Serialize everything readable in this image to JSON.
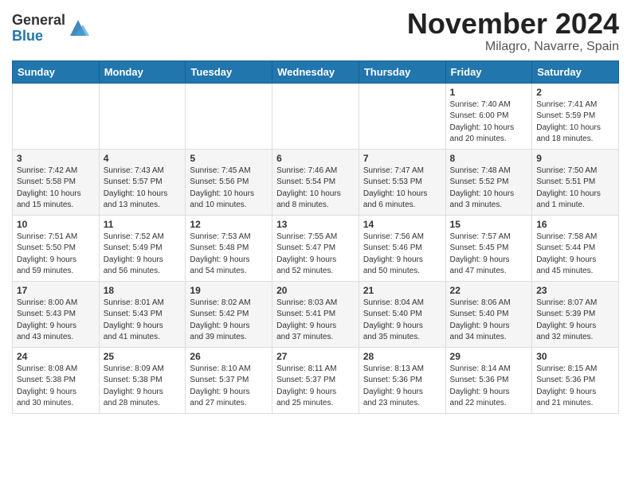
{
  "header": {
    "logo_general": "General",
    "logo_blue": "Blue",
    "month_title": "November 2024",
    "location": "Milagro, Navarre, Spain"
  },
  "weekdays": [
    "Sunday",
    "Monday",
    "Tuesday",
    "Wednesday",
    "Thursday",
    "Friday",
    "Saturday"
  ],
  "weeks": [
    [
      {
        "day": "",
        "info": ""
      },
      {
        "day": "",
        "info": ""
      },
      {
        "day": "",
        "info": ""
      },
      {
        "day": "",
        "info": ""
      },
      {
        "day": "",
        "info": ""
      },
      {
        "day": "1",
        "info": "Sunrise: 7:40 AM\nSunset: 6:00 PM\nDaylight: 10 hours\nand 20 minutes."
      },
      {
        "day": "2",
        "info": "Sunrise: 7:41 AM\nSunset: 5:59 PM\nDaylight: 10 hours\nand 18 minutes."
      }
    ],
    [
      {
        "day": "3",
        "info": "Sunrise: 7:42 AM\nSunset: 5:58 PM\nDaylight: 10 hours\nand 15 minutes."
      },
      {
        "day": "4",
        "info": "Sunrise: 7:43 AM\nSunset: 5:57 PM\nDaylight: 10 hours\nand 13 minutes."
      },
      {
        "day": "5",
        "info": "Sunrise: 7:45 AM\nSunset: 5:56 PM\nDaylight: 10 hours\nand 10 minutes."
      },
      {
        "day": "6",
        "info": "Sunrise: 7:46 AM\nSunset: 5:54 PM\nDaylight: 10 hours\nand 8 minutes."
      },
      {
        "day": "7",
        "info": "Sunrise: 7:47 AM\nSunset: 5:53 PM\nDaylight: 10 hours\nand 6 minutes."
      },
      {
        "day": "8",
        "info": "Sunrise: 7:48 AM\nSunset: 5:52 PM\nDaylight: 10 hours\nand 3 minutes."
      },
      {
        "day": "9",
        "info": "Sunrise: 7:50 AM\nSunset: 5:51 PM\nDaylight: 10 hours\nand 1 minute."
      }
    ],
    [
      {
        "day": "10",
        "info": "Sunrise: 7:51 AM\nSunset: 5:50 PM\nDaylight: 9 hours\nand 59 minutes."
      },
      {
        "day": "11",
        "info": "Sunrise: 7:52 AM\nSunset: 5:49 PM\nDaylight: 9 hours\nand 56 minutes."
      },
      {
        "day": "12",
        "info": "Sunrise: 7:53 AM\nSunset: 5:48 PM\nDaylight: 9 hours\nand 54 minutes."
      },
      {
        "day": "13",
        "info": "Sunrise: 7:55 AM\nSunset: 5:47 PM\nDaylight: 9 hours\nand 52 minutes."
      },
      {
        "day": "14",
        "info": "Sunrise: 7:56 AM\nSunset: 5:46 PM\nDaylight: 9 hours\nand 50 minutes."
      },
      {
        "day": "15",
        "info": "Sunrise: 7:57 AM\nSunset: 5:45 PM\nDaylight: 9 hours\nand 47 minutes."
      },
      {
        "day": "16",
        "info": "Sunrise: 7:58 AM\nSunset: 5:44 PM\nDaylight: 9 hours\nand 45 minutes."
      }
    ],
    [
      {
        "day": "17",
        "info": "Sunrise: 8:00 AM\nSunset: 5:43 PM\nDaylight: 9 hours\nand 43 minutes."
      },
      {
        "day": "18",
        "info": "Sunrise: 8:01 AM\nSunset: 5:43 PM\nDaylight: 9 hours\nand 41 minutes."
      },
      {
        "day": "19",
        "info": "Sunrise: 8:02 AM\nSunset: 5:42 PM\nDaylight: 9 hours\nand 39 minutes."
      },
      {
        "day": "20",
        "info": "Sunrise: 8:03 AM\nSunset: 5:41 PM\nDaylight: 9 hours\nand 37 minutes."
      },
      {
        "day": "21",
        "info": "Sunrise: 8:04 AM\nSunset: 5:40 PM\nDaylight: 9 hours\nand 35 minutes."
      },
      {
        "day": "22",
        "info": "Sunrise: 8:06 AM\nSunset: 5:40 PM\nDaylight: 9 hours\nand 34 minutes."
      },
      {
        "day": "23",
        "info": "Sunrise: 8:07 AM\nSunset: 5:39 PM\nDaylight: 9 hours\nand 32 minutes."
      }
    ],
    [
      {
        "day": "24",
        "info": "Sunrise: 8:08 AM\nSunset: 5:38 PM\nDaylight: 9 hours\nand 30 minutes."
      },
      {
        "day": "25",
        "info": "Sunrise: 8:09 AM\nSunset: 5:38 PM\nDaylight: 9 hours\nand 28 minutes."
      },
      {
        "day": "26",
        "info": "Sunrise: 8:10 AM\nSunset: 5:37 PM\nDaylight: 9 hours\nand 27 minutes."
      },
      {
        "day": "27",
        "info": "Sunrise: 8:11 AM\nSunset: 5:37 PM\nDaylight: 9 hours\nand 25 minutes."
      },
      {
        "day": "28",
        "info": "Sunrise: 8:13 AM\nSunset: 5:36 PM\nDaylight: 9 hours\nand 23 minutes."
      },
      {
        "day": "29",
        "info": "Sunrise: 8:14 AM\nSunset: 5:36 PM\nDaylight: 9 hours\nand 22 minutes."
      },
      {
        "day": "30",
        "info": "Sunrise: 8:15 AM\nSunset: 5:36 PM\nDaylight: 9 hours\nand 21 minutes."
      }
    ]
  ]
}
